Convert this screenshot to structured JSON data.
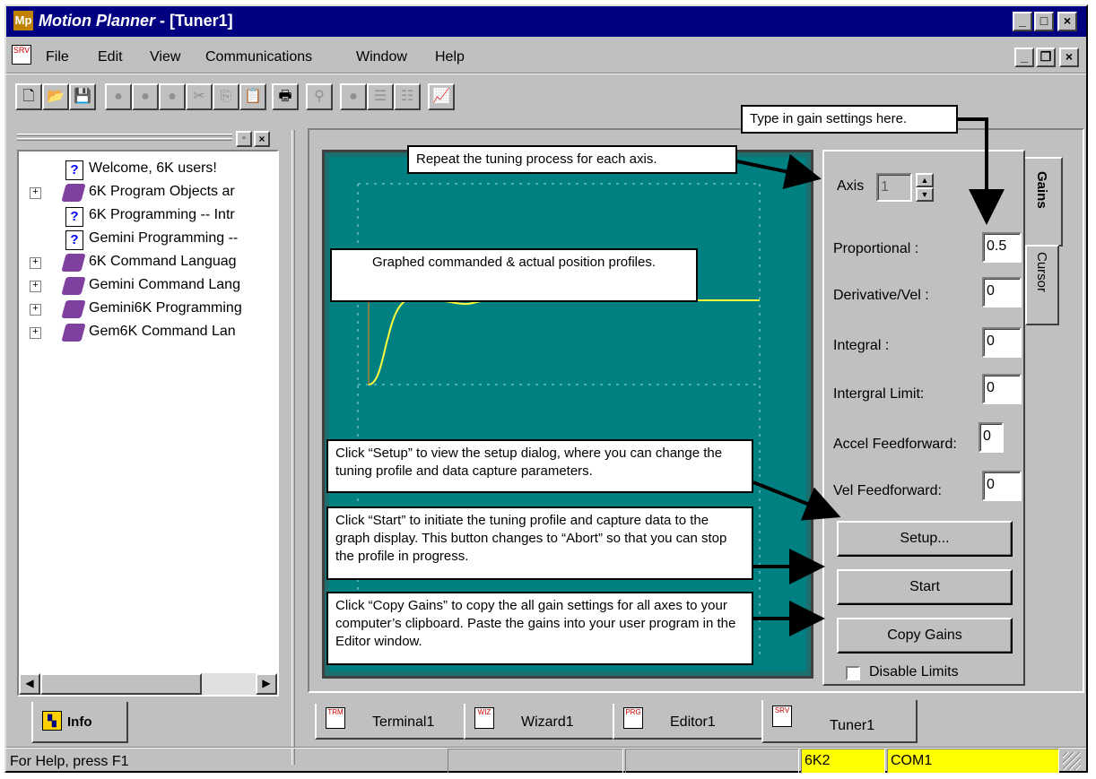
{
  "window": {
    "app_name": "Motion Planner",
    "doc_title": " - [Tuner1]"
  },
  "menu": {
    "file": "File",
    "edit": "Edit",
    "view": "View",
    "communications": "Communications",
    "window": "Window",
    "help": "Help"
  },
  "tree": {
    "items": [
      {
        "label": "Welcome, 6K users!",
        "icon": "help-page-icon",
        "expandable": false
      },
      {
        "label": "6K Program Objects ar",
        "icon": "book-icon",
        "expandable": true
      },
      {
        "label": "6K Programming -- Intr",
        "icon": "help-page-icon",
        "expandable": false
      },
      {
        "label": "Gemini Programming --",
        "icon": "help-page-icon",
        "expandable": false
      },
      {
        "label": "6K Command Languag",
        "icon": "book-icon",
        "expandable": true
      },
      {
        "label": "Gemini Command Lang",
        "icon": "book-icon",
        "expandable": true
      },
      {
        "label": "Gemini6K Programming",
        "icon": "book-icon",
        "expandable": true
      },
      {
        "label": "Gem6K Command Lan",
        "icon": "book-icon",
        "expandable": true
      }
    ],
    "tab_label": "Info"
  },
  "tuner": {
    "axis_label": "Axis",
    "axis_value": "1",
    "gains_tab": "Gains",
    "cursor_tab": "Cursor",
    "fields": [
      {
        "label": "Proportional :",
        "value": "0.5"
      },
      {
        "label": "Derivative/Vel :",
        "value": "0"
      },
      {
        "label": "Integral :",
        "value": "0"
      },
      {
        "label": "Intergral Limit:",
        "value": "0"
      },
      {
        "label": "Accel Feedforward:",
        "value": "0"
      },
      {
        "label": "Vel  Feedforward:",
        "value": "0"
      }
    ],
    "setup_button": "Setup...",
    "start_button": "Start",
    "copy_gains_button": "Copy Gains",
    "disable_limits": "Disable Limits"
  },
  "callouts": {
    "gain": "Type in gain settings here.",
    "axis": "Repeat the tuning process for each axis.",
    "graph": "Graphed commanded & actual position profiles.",
    "setup": "Click “Setup” to view the setup dialog, where you can change the tuning profile and data capture parameters.",
    "start": "Click “Start” to initiate the tuning profile and capture data to the graph display. This button changes to “Abort” so that you can stop the profile in progress.",
    "copy": "Click “Copy Gains” to copy the all gain settings for all axes to your computer’s clipboard. Paste the gains into your user program in the Editor window."
  },
  "doc_tabs": [
    {
      "label": "Terminal1",
      "badge": "TRM"
    },
    {
      "label": "Wizard1",
      "badge": "WIZ"
    },
    {
      "label": "Editor1",
      "badge": "PRG"
    },
    {
      "label": "Tuner1",
      "badge": "SRV"
    }
  ],
  "status": {
    "help_text": "For Help, press F1",
    "product": "6K2",
    "port": "COM1"
  },
  "colors": {
    "title_bg": "#000080",
    "graph_bg": "#008080",
    "trace": "#ffff40",
    "status_highlight": "#ffff00"
  }
}
